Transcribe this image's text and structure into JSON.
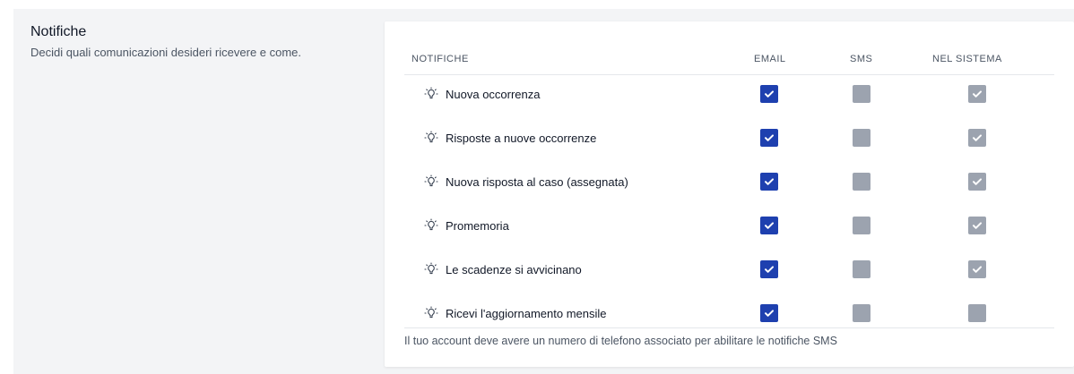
{
  "section": {
    "title": "Notifiche",
    "description": "Decidi quali comunicazioni desideri ricevere e come."
  },
  "table": {
    "headers": [
      "NOTIFICHE",
      "EMAIL",
      "SMS",
      "NEL SISTEMA"
    ],
    "rows": [
      {
        "label": "Nuova occorrenza",
        "email": true,
        "sms": false,
        "system": true
      },
      {
        "label": "Risposte a nuove occorrenze",
        "email": true,
        "sms": false,
        "system": true
      },
      {
        "label": "Nuova risposta al caso (assegnata)",
        "email": true,
        "sms": false,
        "system": true
      },
      {
        "label": "Promemoria",
        "email": true,
        "sms": false,
        "system": true
      },
      {
        "label": "Le scadenze si avvicinano",
        "email": true,
        "sms": false,
        "system": true
      },
      {
        "label": "Ricevi l'aggiornamento mensile",
        "email": true,
        "sms": false,
        "system": false
      }
    ],
    "icon": "lightbulb-icon"
  },
  "footer_note": "Il tuo account deve avere un numero di telefono associato per abilitare le notifiche SMS",
  "colors": {
    "checked_email": "#1e40af",
    "disabled": "#9ca3af",
    "background": "#f3f4f6"
  }
}
